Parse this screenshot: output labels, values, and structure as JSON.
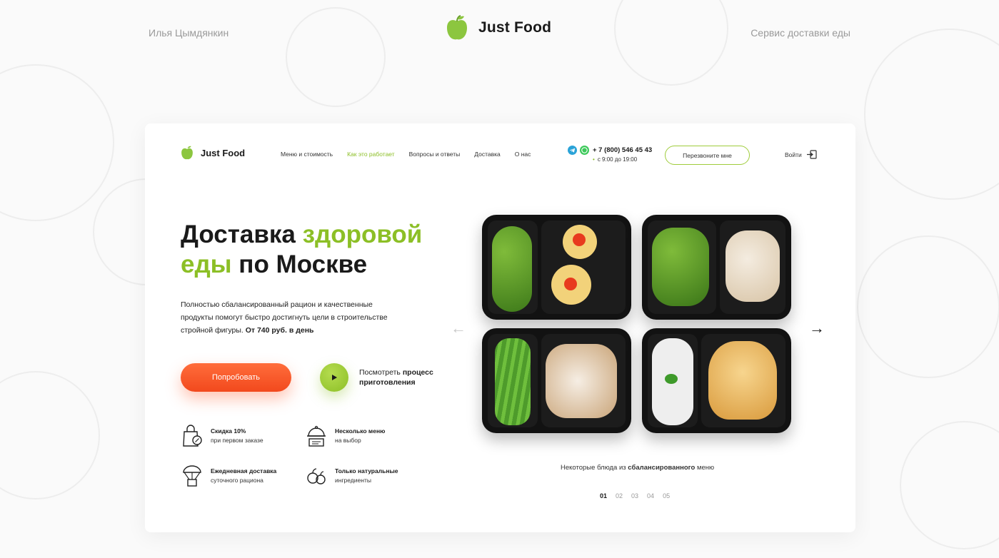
{
  "presentation": {
    "author": "Илья Цымдянкин",
    "brand": "Just Food",
    "tagline": "Сервис доставки еды"
  },
  "nav": {
    "brand": "Just Food",
    "links": [
      {
        "label": "Меню и стоимость",
        "active": false
      },
      {
        "label": "Как это работает",
        "active": true
      },
      {
        "label": "Вопросы и ответы",
        "active": false
      },
      {
        "label": "Доставка",
        "active": false
      },
      {
        "label": "О нас",
        "active": false
      }
    ],
    "phone": "+ 7 (800) 546 45 43",
    "hours": "с 9:00 до 19:00",
    "callback_label": "Перезвоните мне",
    "login_label": "Войти"
  },
  "hero": {
    "title_part1": "Доставка ",
    "title_green1": "здоровой",
    "title_green2": "еды",
    "title_part2": " по Москве",
    "desc": "Полностью сбалансированный рацион и качественные продукты помогут быстро достигнуть цели в строительстве стройной фигуры.",
    "price": "От 740 руб. в день",
    "try_label": "Попробовать",
    "watch_prefix": "Посмотреть",
    "watch_bold": "процесс приготовления"
  },
  "features": [
    {
      "title": "Скидка 10%",
      "sub": "при первом заказе",
      "icon": "discount-bag-icon"
    },
    {
      "title": "Несколько меню",
      "sub": "на выбор",
      "icon": "menu-cloche-icon"
    },
    {
      "title": "Ежедневная доставка",
      "sub": "суточного рациона",
      "icon": "parachute-box-icon"
    },
    {
      "title": "Только натуральные",
      "sub": "ингредиенты",
      "icon": "fruits-icon"
    }
  ],
  "gallery": {
    "caption_prefix": "Некоторые блюда из",
    "caption_bold": "сбалансированного",
    "caption_suffix": "меню",
    "pages": [
      "01",
      "02",
      "03",
      "04",
      "05"
    ],
    "active_page": 0
  },
  "colors": {
    "accent": "#8cbf26",
    "orange": "#f2491d"
  }
}
